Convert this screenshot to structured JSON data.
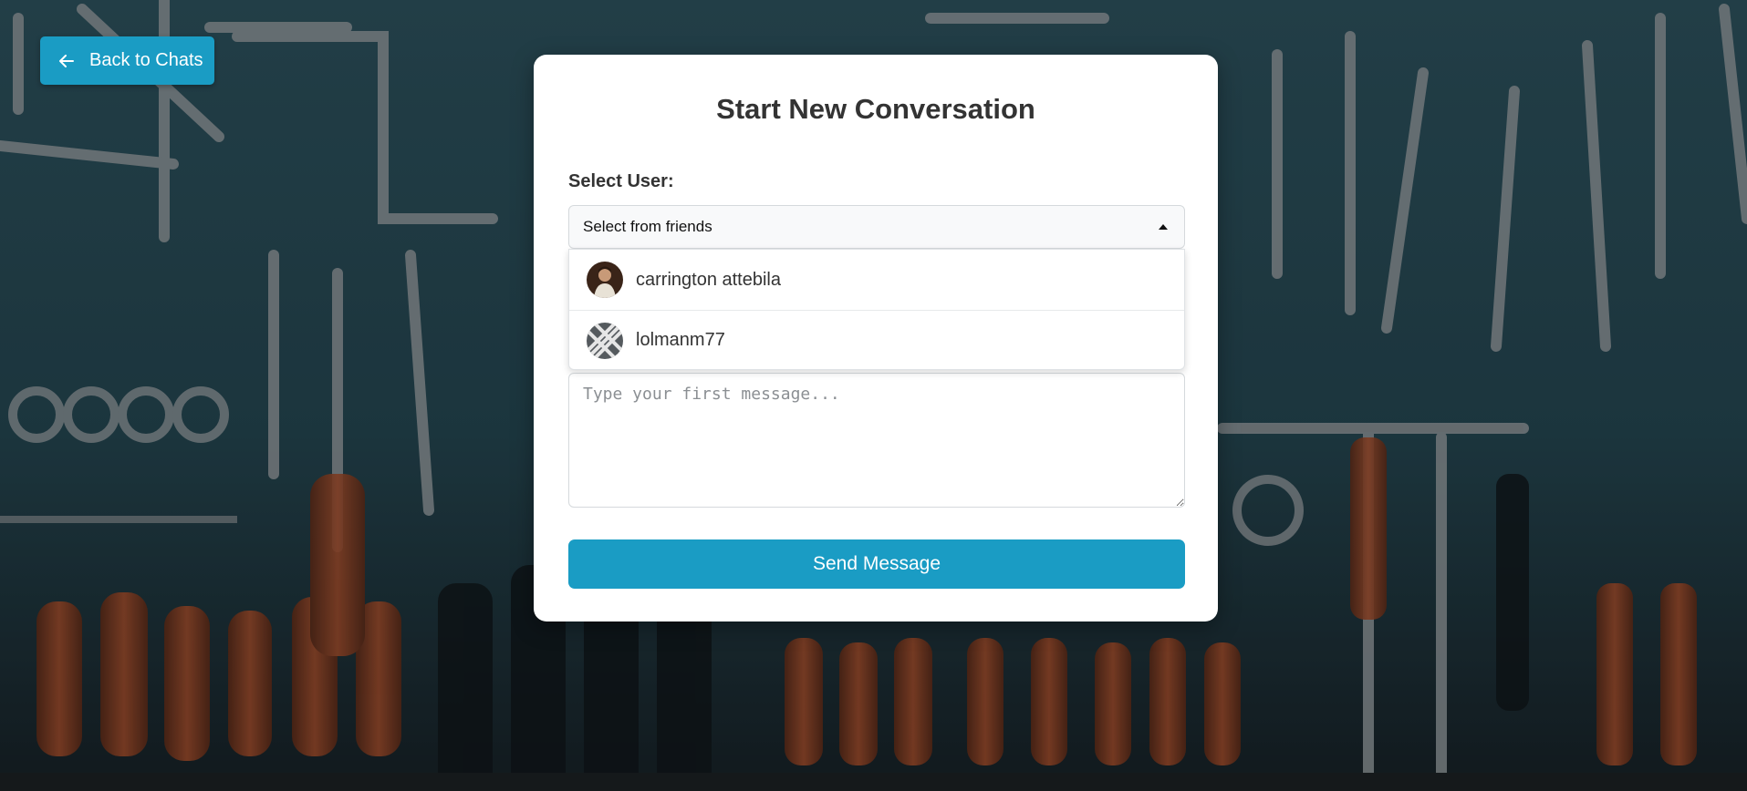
{
  "nav": {
    "back_label": "Back to Chats",
    "back_icon": "arrow-left-icon"
  },
  "card": {
    "title": "Start New Conversation",
    "select_label": "Select User:",
    "select_value": "Select from friends",
    "options": [
      {
        "name": "carrington attebila",
        "avatar": "portrait-avatar"
      },
      {
        "name": "lolmanm77",
        "avatar": "pattern-avatar"
      }
    ],
    "message_placeholder": "Type your first message...",
    "send_label": "Send Message"
  },
  "colors": {
    "accent": "#1a9cc4",
    "background": "#1f3a44"
  }
}
